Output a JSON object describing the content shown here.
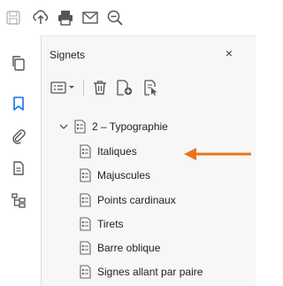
{
  "toolbar": {
    "icons": [
      "save-icon",
      "upload-icon",
      "print-icon",
      "email-icon",
      "zoom-out-icon"
    ]
  },
  "left_bar": {
    "icons": [
      "copy-pages-icon",
      "bookmark-icon",
      "attachment-icon",
      "page-thumbnail-icon",
      "structure-tree-icon"
    ],
    "selected": "bookmark-icon"
  },
  "panel": {
    "title": "Signets",
    "close_label": "×",
    "tools": [
      "options-menu-icon",
      "delete-icon",
      "new-bookmark-icon",
      "find-bookmark-icon"
    ]
  },
  "tree": {
    "parent": {
      "label": "2 – Typographie",
      "expanded": true
    },
    "children": [
      {
        "label": "Italiques"
      },
      {
        "label": "Majuscules"
      },
      {
        "label": "Points cardinaux"
      },
      {
        "label": "Tirets"
      },
      {
        "label": "Barre oblique"
      },
      {
        "label": "Signes allant par paire"
      }
    ]
  },
  "colors": {
    "accent_blue": "#1473e6",
    "callout_orange": "#e8741c",
    "panel_bg": "#f7f7f7",
    "icon_gray": "#6b6b6b"
  }
}
